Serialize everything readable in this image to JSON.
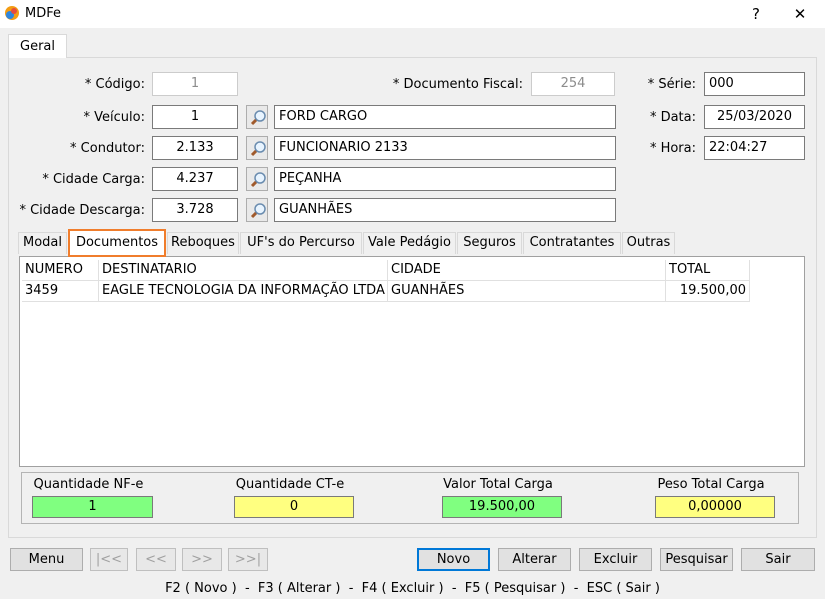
{
  "window": {
    "title": "MDFe",
    "help_label": "?",
    "close_label": "✕"
  },
  "main_tab": "Geral",
  "form": {
    "codigo_label": "* Código:",
    "codigo_value": "1",
    "doc_fiscal_label": "* Documento Fiscal:",
    "doc_fiscal_value": "254",
    "serie_label": "* Série:",
    "serie_value": "000",
    "veiculo_label": "* Veículo:",
    "veiculo_code": "1",
    "veiculo_name": "FORD CARGO",
    "data_label": "* Data:",
    "data_value": "25/03/2020",
    "condutor_label": "* Condutor:",
    "condutor_code": "2.133",
    "condutor_name": "FUNCIONARIO 2133",
    "hora_label": "* Hora:",
    "hora_value": "22:04:27",
    "cidade_carga_label": "* Cidade Carga:",
    "cidade_carga_code": "4.237",
    "cidade_carga_name": "PEÇANHA",
    "cidade_descarga_label": "* Cidade Descarga:",
    "cidade_descarga_code": "3.728",
    "cidade_descarga_name": "GUANHÃES"
  },
  "subtabs": [
    "Modal",
    "Documentos",
    "Reboques",
    "UF's do Percurso",
    "Vale Pedágio",
    "Seguros",
    "Contratantes",
    "Outras"
  ],
  "active_subtab": "Documentos",
  "grid": {
    "headers": [
      "NUMERO",
      "DESTINATARIO",
      "CIDADE",
      "TOTAL"
    ],
    "rows": [
      [
        "3459",
        "EAGLE TECNOLOGIA DA INFORMAÇÃO LTDA",
        "GUANHÃES",
        "19.500,00"
      ]
    ]
  },
  "totals": {
    "qtd_nfe_label": "Quantidade NF-e",
    "qtd_nfe_value": "1",
    "qtd_cte_label": "Quantidade CT-e",
    "qtd_cte_value": "0",
    "valor_total_label": "Valor Total Carga",
    "valor_total_value": "19.500,00",
    "peso_total_label": "Peso Total Carga",
    "peso_total_value": "0,00000"
  },
  "colors": {
    "green": "#80ff80",
    "yellow": "#ffff80",
    "accent": "#f07d2c",
    "focus": "#0078d7"
  },
  "buttons": {
    "menu": "Menu",
    "first": "|<<",
    "prev": "<<",
    "next": ">>",
    "last": ">>|",
    "novo": "Novo",
    "alterar": "Alterar",
    "excluir": "Excluir",
    "pesquisar": "Pesquisar",
    "sair": "Sair"
  },
  "status_text": "F2 ( Novo )  -  F3 ( Alterar )  -  F4 ( Excluir )  -  F5 ( Pesquisar )  -  ESC ( Sair )"
}
